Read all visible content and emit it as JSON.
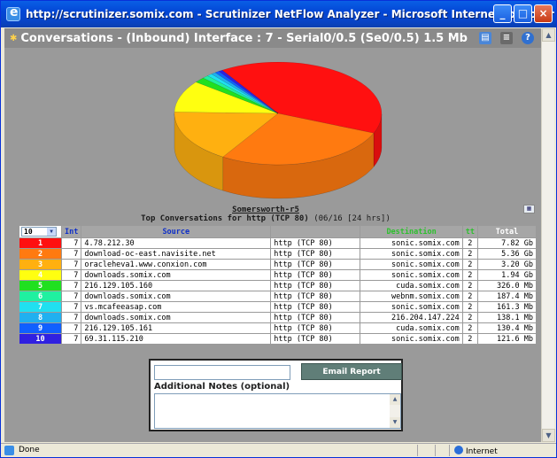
{
  "window": {
    "title": "http://scrutinizer.somix.com - Scrutinizer NetFlow Analyzer - Microsoft Internet Explorer",
    "minimize": "_",
    "maximize": "□",
    "close": "×"
  },
  "page_header": {
    "title": "Conversations - (Inbound) Interface : 7 - Serial0/0.5 (Se0/0.5) 1.5 Mb"
  },
  "report": {
    "router_name": "Somersworth-r5",
    "subtitle": "Top Conversations for http (TCP 80)",
    "date_range": "(06/16 [24 hrs])"
  },
  "table": {
    "rows_select": "10",
    "headers": {
      "int": "Int",
      "source": "Source",
      "blank": "",
      "destination": "Destination",
      "tt": "tt",
      "total": "Total"
    },
    "rows": [
      {
        "rank": "1",
        "int": "7",
        "source": "4.78.212.30",
        "app": "http (TCP 80)",
        "dest": "sonic.somix.com",
        "tt": "2",
        "total": "7.82 Gb",
        "color": "#ff1010"
      },
      {
        "rank": "2",
        "int": "7",
        "source": "download-oc-east.navisite.net",
        "app": "http (TCP 80)",
        "dest": "sonic.somix.com",
        "tt": "2",
        "total": "5.36 Gb",
        "color": "#ff7a10"
      },
      {
        "rank": "3",
        "int": "7",
        "source": "oracleheva1.www.conxion.com",
        "app": "http (TCP 80)",
        "dest": "sonic.somix.com",
        "tt": "2",
        "total": "3.20 Gb",
        "color": "#ffb010"
      },
      {
        "rank": "4",
        "int": "7",
        "source": "downloads.somix.com",
        "app": "http (TCP 80)",
        "dest": "sonic.somix.com",
        "tt": "2",
        "total": "1.94 Gb",
        "color": "#ffff10"
      },
      {
        "rank": "5",
        "int": "7",
        "source": "216.129.105.160",
        "app": "http (TCP 80)",
        "dest": "cuda.somix.com",
        "tt": "2",
        "total": "326.0 Mb",
        "color": "#20e020"
      },
      {
        "rank": "6",
        "int": "7",
        "source": "downloads.somix.com",
        "app": "http (TCP 80)",
        "dest": "webnm.somix.com",
        "tt": "2",
        "total": "187.4 Mb",
        "color": "#20f0a0"
      },
      {
        "rank": "7",
        "int": "7",
        "source": "vs.mcafeeasap.com",
        "app": "http (TCP 80)",
        "dest": "sonic.somix.com",
        "tt": "2",
        "total": "161.3 Mb",
        "color": "#20e0f0"
      },
      {
        "rank": "8",
        "int": "7",
        "source": "downloads.somix.com",
        "app": "http (TCP 80)",
        "dest": "216.204.147.224",
        "tt": "2",
        "total": "138.1 Mb",
        "color": "#20b0f0"
      },
      {
        "rank": "9",
        "int": "7",
        "source": "216.129.105.161",
        "app": "http (TCP 80)",
        "dest": "cuda.somix.com",
        "tt": "2",
        "total": "130.4 Mb",
        "color": "#1060ff"
      },
      {
        "rank": "10",
        "int": "7",
        "source": "69.31.115.210",
        "app": "http (TCP 80)",
        "dest": "sonic.somix.com",
        "tt": "2",
        "total": "121.6 Mb",
        "color": "#3020e0"
      }
    ]
  },
  "notes": {
    "email_button": "Email Report",
    "label": "Additional Notes (optional)"
  },
  "status": {
    "text": "Done",
    "zone": "Internet"
  },
  "chart_data": {
    "type": "pie",
    "categories": [
      "1",
      "2",
      "3",
      "4",
      "5",
      "6",
      "7",
      "8",
      "9",
      "10"
    ],
    "values": [
      7.82,
      5.36,
      3.2,
      1.94,
      0.326,
      0.1874,
      0.1613,
      0.1381,
      0.1304,
      0.1216
    ],
    "unit": "Gb",
    "colors": [
      "#ff1010",
      "#ff7a10",
      "#ffb010",
      "#ffff10",
      "#20e020",
      "#20f0a0",
      "#20e0f0",
      "#20b0f0",
      "#1060ff",
      "#3020e0"
    ]
  }
}
